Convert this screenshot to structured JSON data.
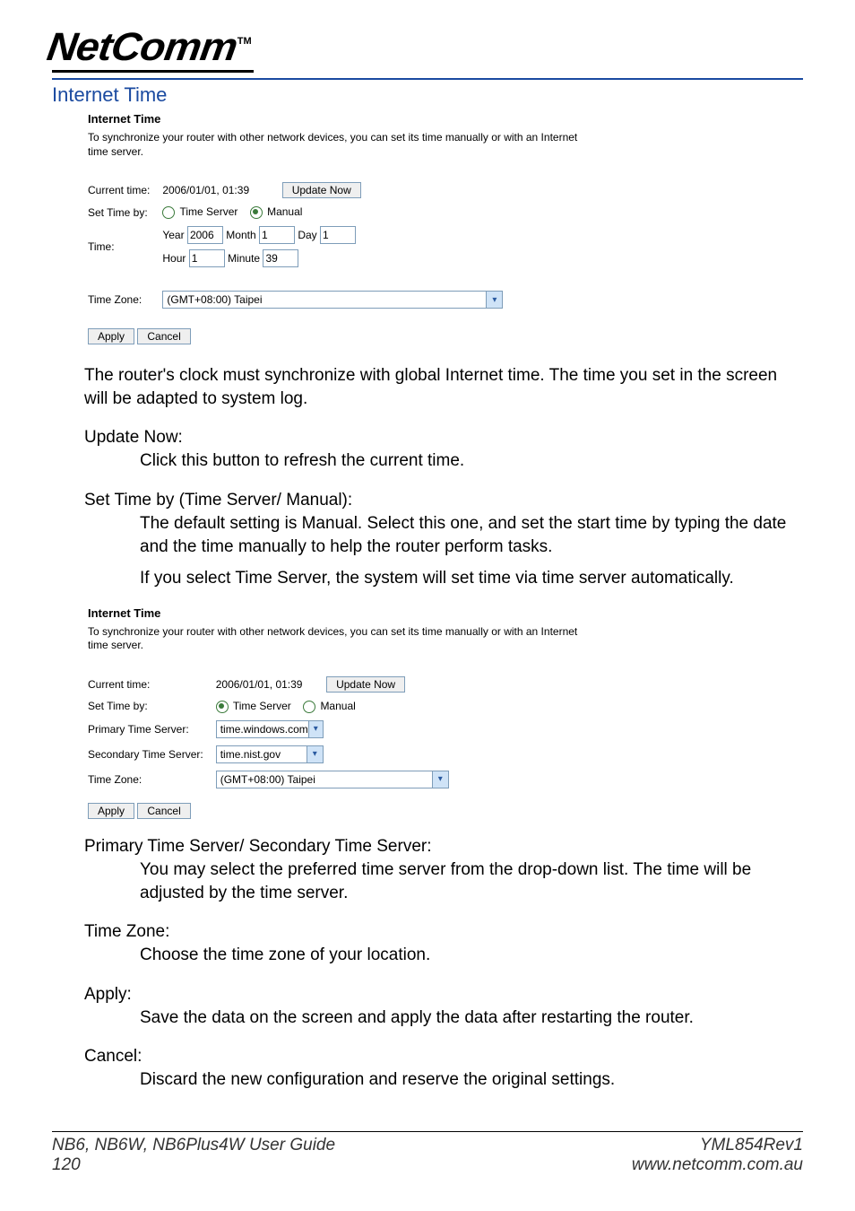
{
  "brand": {
    "name": "NetComm",
    "tm": "TM"
  },
  "section_title": "Internet Time",
  "shot1": {
    "title": "Internet Time",
    "desc": "To synchronize your router with other network devices, you can set its time manually or with an Internet time server.",
    "rows": {
      "current_time_lbl": "Current time:",
      "current_time_val": "2006/01/01, 01:39",
      "update_now": "Update Now",
      "set_time_by_lbl": "Set Time by:",
      "opt_time_server": "Time Server",
      "opt_manual": "Manual",
      "time_lbl": "Time:",
      "year_lbl": "Year",
      "year_val": "2006",
      "month_lbl": "Month",
      "month_val": "1",
      "day_lbl": "Day",
      "day_val": "1",
      "hour_lbl": "Hour",
      "hour_val": "1",
      "minute_lbl": "Minute",
      "minute_val": "39",
      "tz_lbl": "Time Zone:",
      "tz_val": "(GMT+08:00) Taipei",
      "apply": "Apply",
      "cancel": "Cancel"
    }
  },
  "para1": "The router's clock must synchronize with global Internet time. The time you set in the screen will be adapted to system log.",
  "f_update_now_lbl": "Update Now:",
  "f_update_now_desc": "Click this button to refresh the current time.",
  "f_settime_lbl": "Set Time by (Time Server/ Manual):",
  "f_settime_desc1": "The default setting is Manual. Select this one, and set the start time by typing the date and the time manually to help the router perform tasks.",
  "f_settime_desc2": "If you select Time Server, the system will set time via time server automatically.",
  "shot2": {
    "title": "Internet Time",
    "desc": "To synchronize your router with other network devices, you can set its time manually or with an Internet time server.",
    "rows": {
      "current_time_lbl": "Current time:",
      "current_time_val": "2006/01/01, 01:39",
      "update_now": "Update Now",
      "set_time_by_lbl": "Set Time by:",
      "opt_time_server": "Time Server",
      "opt_manual": "Manual",
      "pts_lbl": "Primary Time Server:",
      "pts_val": "time.windows.com",
      "sts_lbl": "Secondary Time Server:",
      "sts_val": "time.nist.gov",
      "tz_lbl": "Time Zone:",
      "tz_val": "(GMT+08:00) Taipei",
      "apply": "Apply",
      "cancel": "Cancel"
    }
  },
  "f_ts_lbl": "Primary Time Server/ Secondary Time Server:",
  "f_ts_desc": "You may select the preferred time server from the drop-down list. The time will be adjusted by the time server.",
  "f_tz_lbl": "Time Zone:",
  "f_tz_desc": "Choose the time zone of your location.",
  "f_apply_lbl": "Apply:",
  "f_apply_desc": "Save the data on the screen and apply the data after restarting the router.",
  "f_cancel_lbl": "Cancel:",
  "f_cancel_desc": "Discard the new configuration and reserve the original settings.",
  "footer": {
    "left1": "NB6, NB6W, NB6Plus4W User Guide",
    "left2": "120",
    "right1": "YML854Rev1",
    "right2": "www.netcomm.com.au"
  }
}
